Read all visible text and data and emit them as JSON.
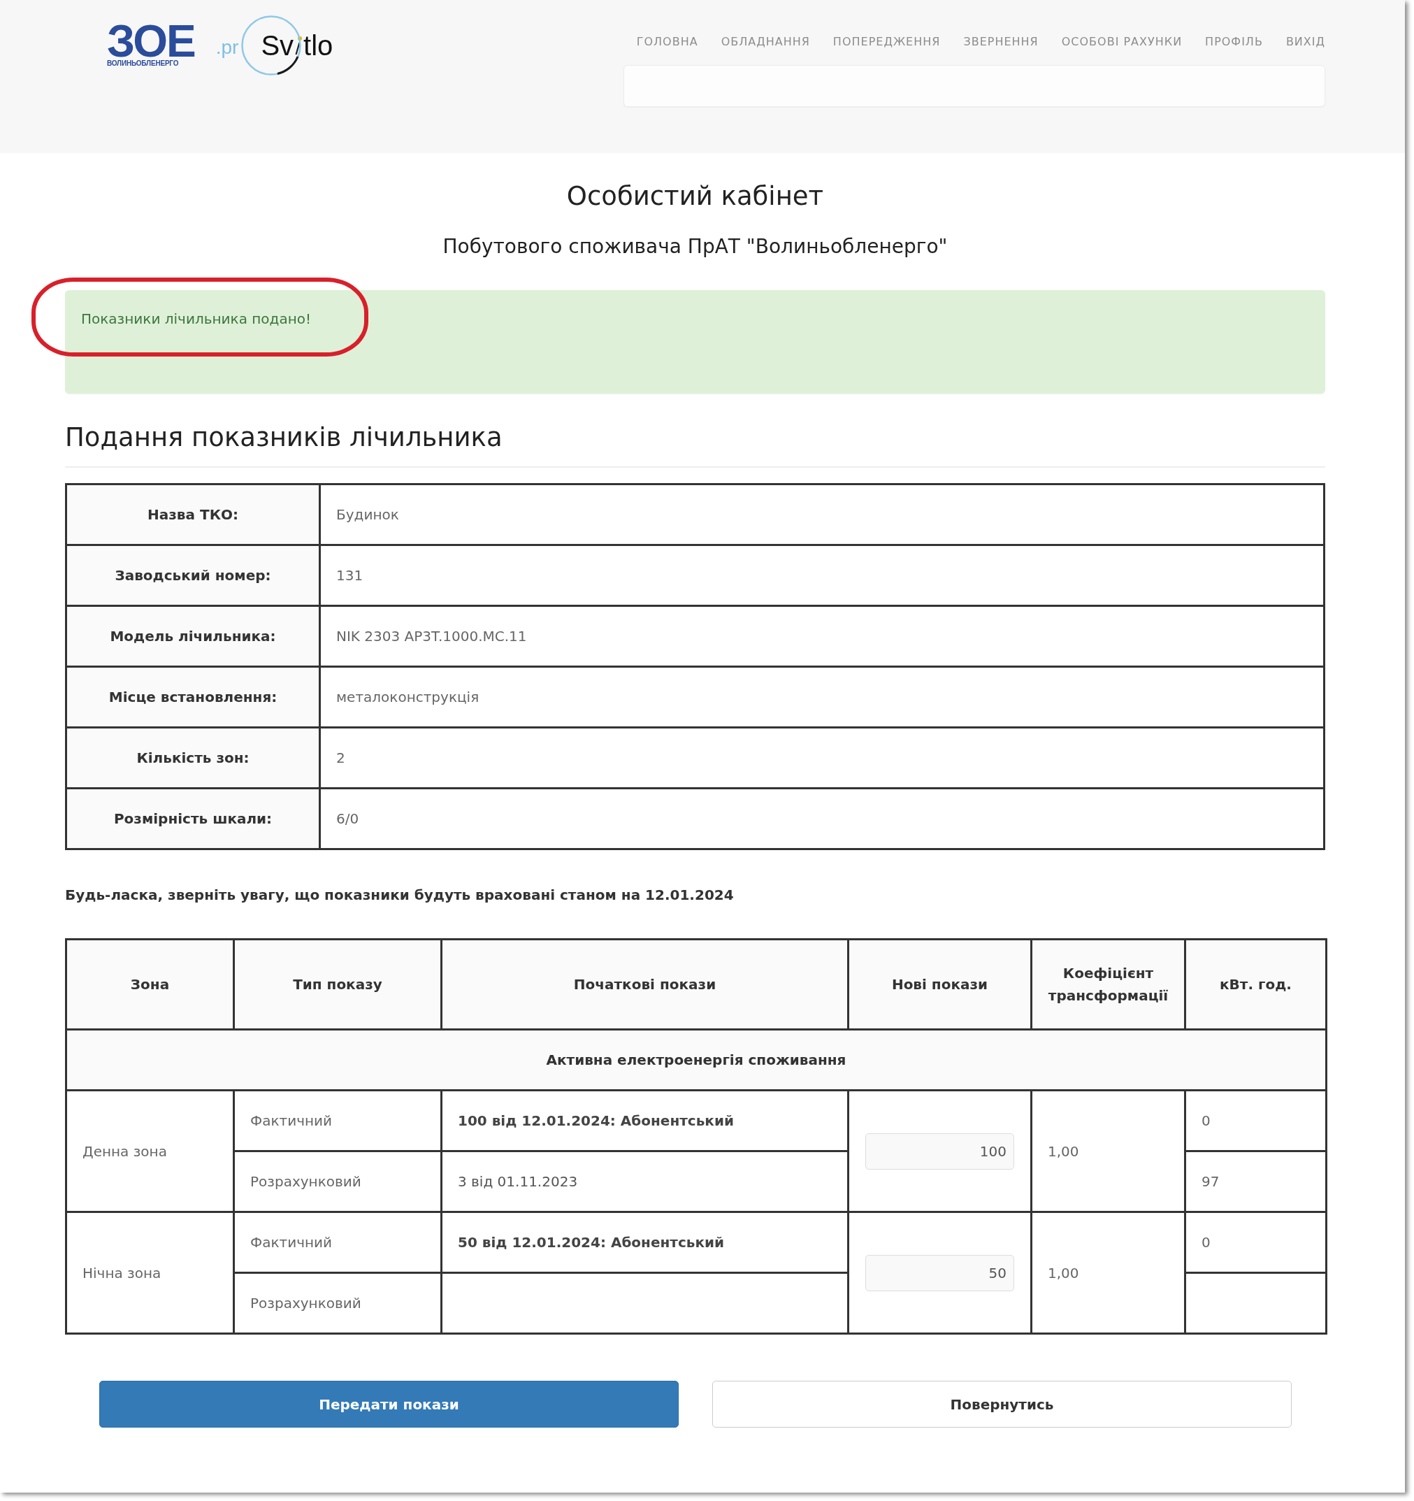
{
  "header": {
    "logo": {
      "letters": "ЗОЕ",
      "caption": "ВОЛИНЬОБЛЕНЕРГО"
    },
    "app_logo": {
      "prefix": ".pr",
      "name_start": "Sv",
      "name_end": "tlo"
    },
    "nav": [
      "ГОЛОВНА",
      "ОБЛАДНАННЯ",
      "ПОПЕРЕДЖЕННЯ",
      "ЗВЕРНЕННЯ",
      "ОСОБОВІ РАХУНКИ",
      "ПРОФІЛЬ",
      "ВИХІД"
    ]
  },
  "title": "Особистий кабінет",
  "subtitle": "Побутового споживача ПрАТ \"Волиньобленерго\"",
  "alert": {
    "kind": "success",
    "text": "Показники лічильника подано!",
    "circled": true
  },
  "section_heading": "Подання показників лічильника",
  "meter_info": [
    {
      "label": "Назва ТКО:",
      "value": "Будинок"
    },
    {
      "label": "Заводський номер:",
      "value": "131"
    },
    {
      "label": "Модель лічильника:",
      "value": "NIK 2303 AP3T.1000.MC.11"
    },
    {
      "label": "Місце встановлення:",
      "value": "металоконструкція"
    },
    {
      "label": "Кількість зон:",
      "value": "2"
    },
    {
      "label": "Розмірність шкали:",
      "value": "6/0"
    }
  ],
  "note": "Будь-ласка, зверніть увагу, що показники будуть враховані станом на 12.01.2024",
  "readings": {
    "columns": [
      "Зона",
      "Тип показу",
      "Початкові покази",
      "Нові покази",
      "Коефіцієнт трансформації",
      "кВт. год."
    ],
    "section": "Активна електроенергія споживання",
    "zones": [
      {
        "name": "Денна зона",
        "new_reading": "100",
        "coefficient": "1,00",
        "rows": [
          {
            "type": "Фактичний",
            "initial": "100 від 12.01.2024: Абонентський",
            "latest": true,
            "kwh": "0"
          },
          {
            "type": "Розрахунковий",
            "initial": "3 від 01.11.2023",
            "latest": false,
            "kwh": "97"
          }
        ]
      },
      {
        "name": "Нічна зона",
        "new_reading": "50",
        "coefficient": "1,00",
        "rows": [
          {
            "type": "Фактичний",
            "initial": "50 від 12.01.2024: Абонентський",
            "latest": true,
            "kwh": "0"
          },
          {
            "type": "Розрахунковий"
          }
        ]
      }
    ]
  },
  "buttons": [
    {
      "label": "Передати покази",
      "kind": "primary"
    },
    {
      "label": "Повернутись",
      "kind": "default"
    }
  ]
}
